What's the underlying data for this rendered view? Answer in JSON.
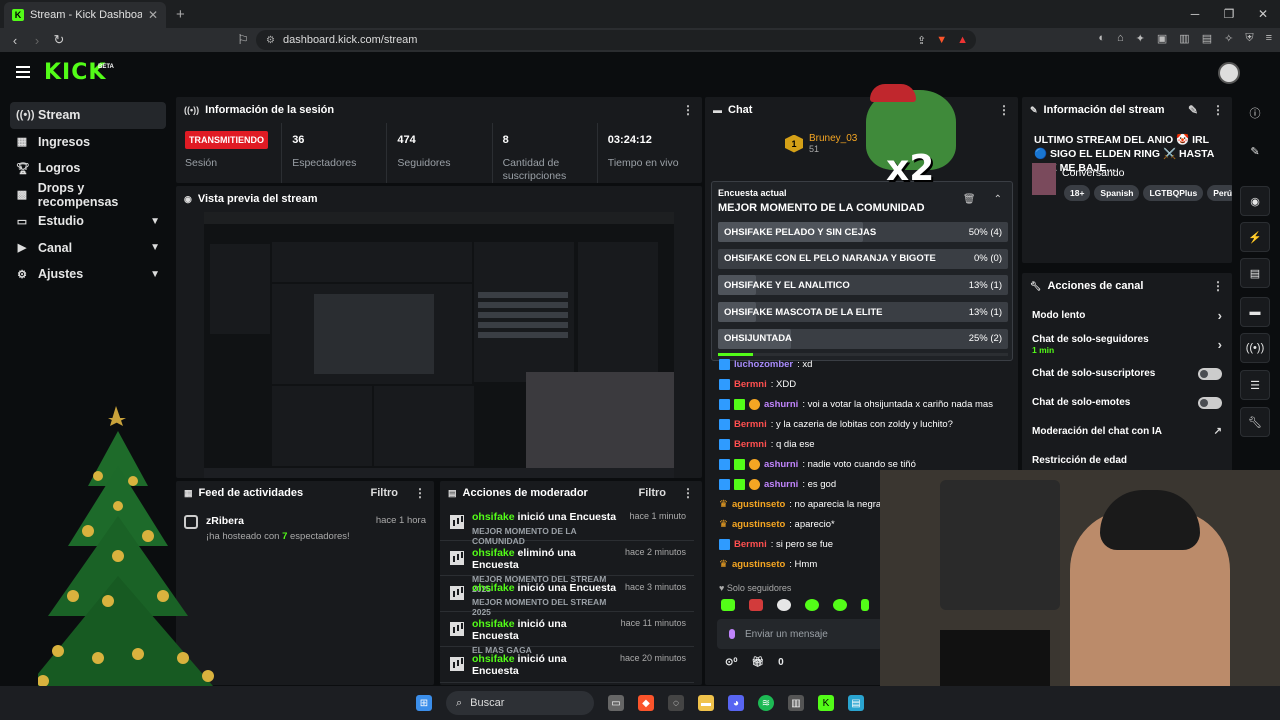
{
  "browser": {
    "tab_title": "Stream - Kick Dashboard",
    "url": "dashboard.kick.com/stream"
  },
  "header": {
    "logo": "KICK",
    "beta": "BETA"
  },
  "sidebar": {
    "items": [
      {
        "label": "Stream",
        "icon": "broadcast-icon"
      },
      {
        "label": "Ingresos",
        "icon": "revenue-icon"
      },
      {
        "label": "Logros",
        "icon": "trophy-icon"
      },
      {
        "label": "Drops y recompensas",
        "icon": "gift-icon"
      },
      {
        "label": "Estudio",
        "icon": "studio-icon"
      },
      {
        "label": "Canal",
        "icon": "channel-icon"
      },
      {
        "label": "Ajustes",
        "icon": "gear-icon"
      }
    ]
  },
  "session": {
    "title": "Información de la sesión",
    "live_badge": "TRANSMITIENDO",
    "live_label": "Sesión",
    "viewers": "36",
    "viewers_label": "Espectadores",
    "followers": "474",
    "followers_label": "Seguidores",
    "subs": "8",
    "subs_label": "Cantidad de suscripciones",
    "time": "03:24:12",
    "time_label": "Tiempo en vivo"
  },
  "preview": {
    "title": "Vista previa del stream"
  },
  "feed": {
    "title": "Feed de actividades",
    "filter": "Filtro",
    "item": {
      "name": "zRibera",
      "time": "hace 1 hora",
      "sub_pre": "¡ha hosteado con ",
      "count": "7",
      "sub_post": " espectadores!"
    }
  },
  "moderator": {
    "title": "Acciones de moderador",
    "filter": "Filtro",
    "items": [
      {
        "user": "ohsifake",
        "action": " inició una Encuesta",
        "time": "hace 1 minuto",
        "sub": "MEJOR MOMENTO DE LA COMUNIDAD"
      },
      {
        "user": "ohsifake",
        "action": " eliminó una Encuesta",
        "time": "hace 2 minutos",
        "sub": "MEJOR MOMENTO DEL STREAM 2025"
      },
      {
        "user": "ohsifake",
        "action": " inició una Encuesta",
        "time": "hace 3 minutos",
        "sub": "MEJOR MOMENTO DEL STREAM 2025"
      },
      {
        "user": "ohsifake",
        "action": " inició una Encuesta",
        "time": "hace 11 minutos",
        "sub": "EL MAS GAGA"
      },
      {
        "user": "ohsifake",
        "action": " inició una Encuesta",
        "time": "hace 20 minutos",
        "sub": ""
      }
    ]
  },
  "chat": {
    "title": "Chat",
    "top_user": "Bruney_03",
    "top_user_count": "51",
    "poll": {
      "label": "Encuesta actual",
      "title": "MEJOR MOMENTO DE LA COMUNIDAD",
      "options": [
        {
          "text": "OHSIFAKE PELADO Y SIN CEJAS",
          "result": "50% (4)",
          "share": 50
        },
        {
          "text": "OHSIFAKE CON EL PELO NARANJA Y BIGOTE",
          "result": "0% (0)",
          "share": 0
        },
        {
          "text": "OHSIFAKE Y EL ANALITICO",
          "result": "13% (1)",
          "share": 13
        },
        {
          "text": "OHSIFAKE MASCOTA DE LA ELITE",
          "result": "13% (1)",
          "share": 13
        },
        {
          "text": "OHSIJUNTADA",
          "result": "25% (2)",
          "share": 25
        }
      ]
    },
    "messages": [
      {
        "user": "luchozomber",
        "text": ": xd",
        "color": "#a78bfa",
        "badge": "b"
      },
      {
        "user": "Bermni",
        "text": ": XDD",
        "color": "#ff4f4f",
        "badge": "b"
      },
      {
        "user": "ashurni",
        "text": ": voi a votar la ohsijuntada x cariño nada mas",
        "color": "#c084fc",
        "badge": "bgo"
      },
      {
        "user": "Bermni",
        "text": ": y la cazeria de lobitas con zoldy y luchito?",
        "color": "#ff4f4f",
        "badge": "b"
      },
      {
        "user": "Bermni",
        "text": ": q dia ese",
        "color": "#ff4f4f",
        "badge": "b"
      },
      {
        "user": "ashurni",
        "text": ": nadie voto cuando se tiñó",
        "color": "#c084fc",
        "badge": "bgo"
      },
      {
        "user": "ashurni",
        "text": ": es god",
        "color": "#c084fc",
        "badge": "bgo"
      },
      {
        "user": "agustinseto",
        "text": ": no aparecia la negra d",
        "color": "#f5a623",
        "badge": "c"
      },
      {
        "user": "agustinseto",
        "text": ": aparecio*",
        "color": "#f5a623",
        "badge": "c"
      },
      {
        "user": "Bermni",
        "text": ": si pero se fue",
        "color": "#ff4f4f",
        "badge": "b"
      },
      {
        "user": "agustinseto",
        "text": ": Hmm",
        "color": "#f5a623",
        "badge": "c"
      }
    ],
    "followers_only": "Solo seguidores",
    "input_placeholder": "Enviar un mensaje",
    "points": "0"
  },
  "stream_info": {
    "title": "Información del stream",
    "stream_title": "ULTIMO STREAM DEL ANIO 🤡 IRL 🔵 SIGO EL ELDEN RING ⚔️ HASTA QUE ME BAJE...",
    "category": "Conversando",
    "tags": [
      "18+",
      "Spanish",
      "LGTBQPlus",
      "Perú"
    ]
  },
  "channel_actions": {
    "title": "Acciones de canal",
    "rows": [
      {
        "label": "Modo lento",
        "type": "arrow",
        "sub": ""
      },
      {
        "label": "Chat de solo-seguidores",
        "type": "arrow",
        "sub": "1 min"
      },
      {
        "label": "Chat de solo-suscriptores",
        "type": "toggle",
        "sub": ""
      },
      {
        "label": "Chat de solo-emotes",
        "type": "toggle",
        "sub": ""
      },
      {
        "label": "Moderación del chat con IA",
        "type": "external",
        "sub": ""
      },
      {
        "label": "Restricción de edad",
        "type": "none",
        "sub": ""
      }
    ]
  },
  "taskbar": {
    "search": "Buscar"
  },
  "overlay": {
    "x2": "x2"
  }
}
